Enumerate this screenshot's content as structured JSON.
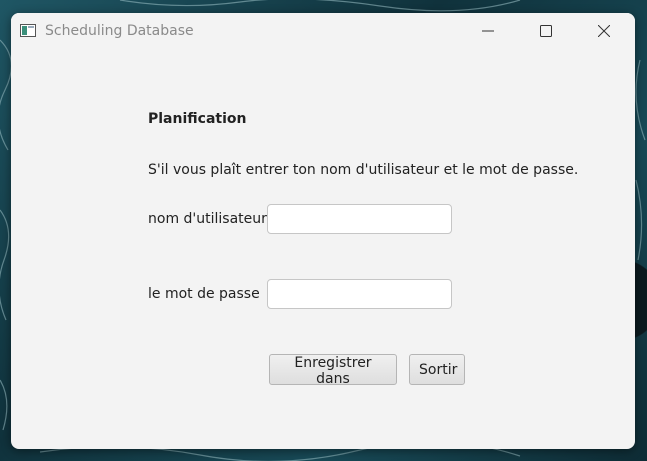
{
  "window": {
    "title": "Scheduling Database"
  },
  "form": {
    "heading": "Planification",
    "instruction": "S'il vous plaît entrer ton nom d'utilisateur et le mot de passe.",
    "username_label": "nom d'utilisateur",
    "username_value": "",
    "password_label": "le mot de passe",
    "password_value": ""
  },
  "buttons": {
    "register_label": "Enregistrer dans",
    "quit_label": "Sortir"
  },
  "icons": {
    "app": "app-window-icon",
    "minimize": "minimize-icon",
    "maximize": "maximize-icon",
    "close": "close-icon"
  },
  "colors": {
    "window_bg": "#f3f3f3",
    "desktop_bg": "#123c48",
    "title_text": "#8a8a8a"
  }
}
